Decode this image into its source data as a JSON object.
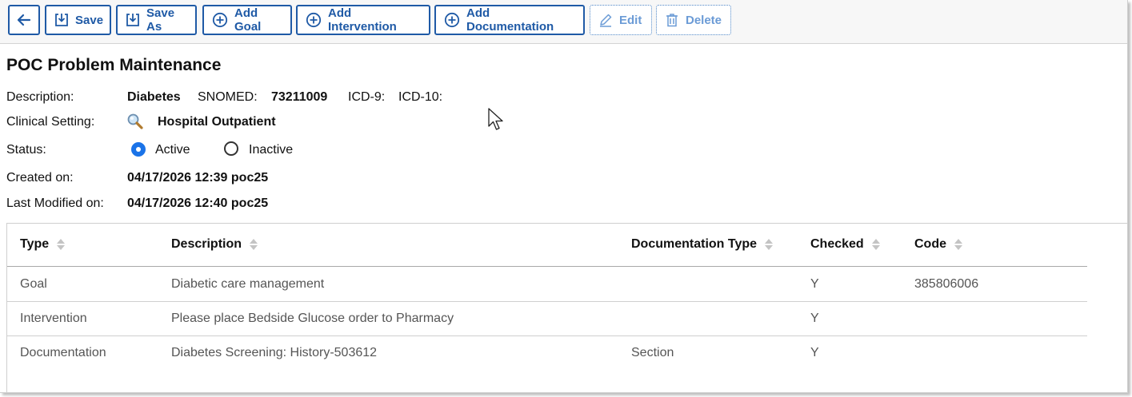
{
  "toolbar": {
    "back_label": "",
    "save_label": "Save",
    "save_as_label": "Save As",
    "add_goal_label": "Add Goal",
    "add_intervention_label": "Add Intervention",
    "add_documentation_label": "Add Documentation",
    "edit_label": "Edit",
    "delete_label": "Delete"
  },
  "page": {
    "title": "POC Problem Maintenance"
  },
  "fields": {
    "description_label": "Description:",
    "description_value": "Diabetes",
    "snomed_label": "SNOMED:",
    "snomed_value": "73211009",
    "icd9_label": "ICD-9:",
    "icd10_label": "ICD-10:",
    "clinical_setting_label": "Clinical Setting:",
    "clinical_setting_value": "Hospital Outpatient",
    "status_label": "Status:",
    "status_active": "Active",
    "status_inactive": "Inactive",
    "status_selected": "Active",
    "created_label": "Created on:",
    "created_value": "04/17/2026 12:39 poc25",
    "modified_label": "Last Modified on:",
    "modified_value": "04/17/2026 12:40 poc25"
  },
  "table": {
    "columns": [
      "Type",
      "Description",
      "Documentation Type",
      "Checked",
      "Code"
    ],
    "rows": [
      {
        "type": "Goal",
        "description": "Diabetic care management",
        "doc_type": "",
        "checked": "Y",
        "code": "385806006"
      },
      {
        "type": "Intervention",
        "description": "Please place Bedside Glucose order to Pharmacy",
        "doc_type": "",
        "checked": "Y",
        "code": ""
      },
      {
        "type": "Documentation",
        "description": "Diabetes Screening: History-503612",
        "doc_type": "Section",
        "checked": "Y",
        "code": ""
      }
    ]
  },
  "colors": {
    "accent": "#1f5aa6",
    "radio_selected": "#1a73e8"
  }
}
